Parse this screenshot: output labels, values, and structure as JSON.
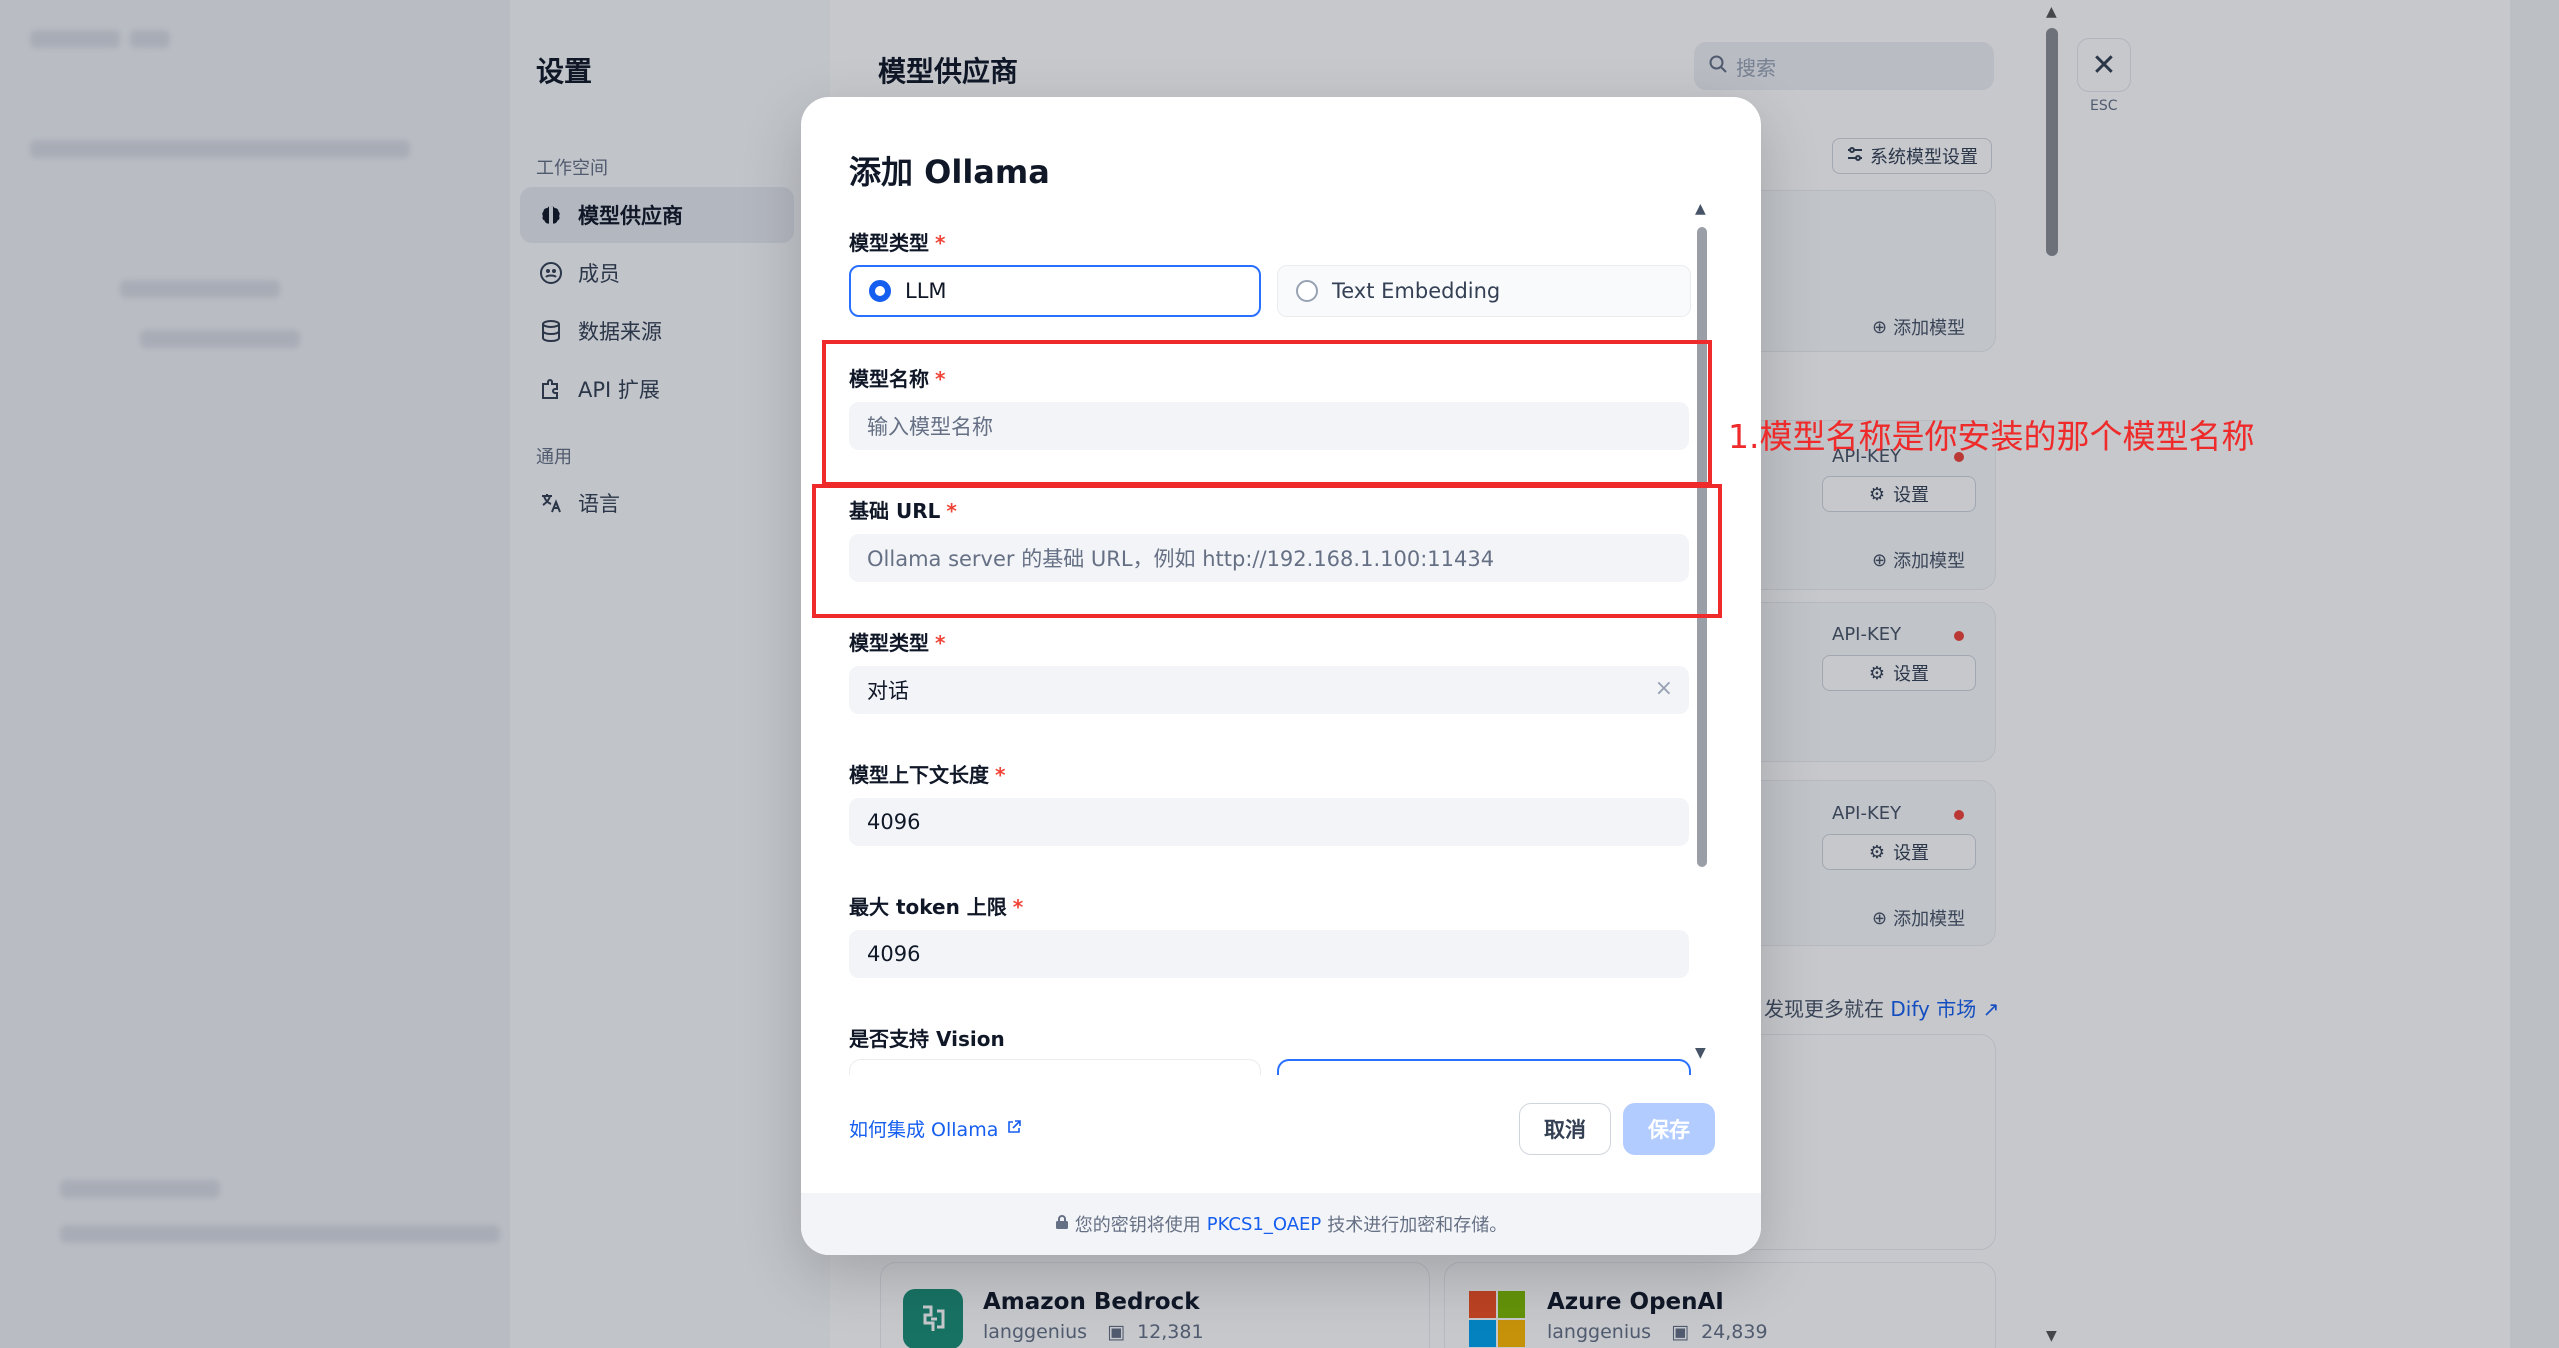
{
  "sidebar": {
    "title": "设置",
    "section_workspace": "工作空间",
    "section_general": "通用",
    "items": [
      {
        "label": "模型供应商",
        "icon": "brain-icon"
      },
      {
        "label": "成员",
        "icon": "members-icon"
      },
      {
        "label": "数据来源",
        "icon": "database-icon"
      },
      {
        "label": "API 扩展",
        "icon": "puzzle-icon"
      },
      {
        "label": "语言",
        "icon": "translate-icon"
      }
    ]
  },
  "main": {
    "title": "模型供应商",
    "search_placeholder": "搜索",
    "system_model_button": "系统模型设置",
    "api_key_label": "API-KEY",
    "setup_label": "设置",
    "add_model_label": "添加模型",
    "discover_text": "发现更多就在",
    "discover_link": "Dify 市场",
    "esc_label": "ESC",
    "cards": [
      {
        "name": "Amazon Bedrock",
        "author": "langgenius",
        "installs": "12,381"
      },
      {
        "name": "Azure OpenAI",
        "author": "langgenius",
        "installs": "24,839"
      }
    ]
  },
  "modal": {
    "title": "添加 Ollama",
    "model_kind_label": "模型类型",
    "kind_options": [
      "LLM",
      "Text Embedding"
    ],
    "kind_selected": "LLM",
    "model_name_label": "模型名称",
    "model_name_placeholder": "输入模型名称",
    "base_url_label": "基础 URL",
    "base_url_placeholder": "Ollama server 的基础 URL，例如 http://192.168.1.100:11434",
    "model_type_label": "模型类型",
    "model_type_value": "对话",
    "context_length_label": "模型上下文长度",
    "context_length_value": "4096",
    "max_token_label": "最大 token 上限",
    "max_token_value": "4096",
    "vision_label": "是否支持 Vision",
    "help_link": "如何集成 Ollama",
    "cancel_label": "取消",
    "save_label": "保存",
    "footer_prefix": "您的密钥将使用",
    "footer_link": "PKCS1_OAEP",
    "footer_suffix": "技术进行加密和存储。"
  },
  "annotation": {
    "text": "1.模型名称是你安装的那个模型名称"
  },
  "colors": {
    "accent": "#155eef",
    "annotation_red": "#ee2a2a",
    "required": "#f04438"
  }
}
